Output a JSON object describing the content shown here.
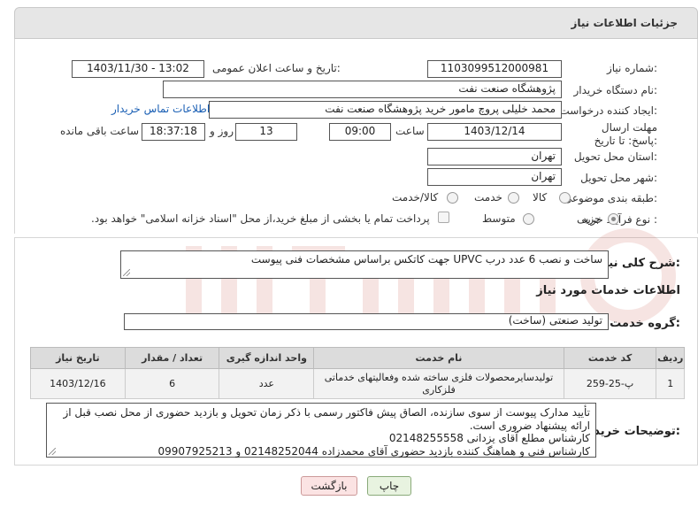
{
  "header": {
    "title": "جزئیات اطلاعات نیاز"
  },
  "fields": {
    "need_number_label": "شماره نیاز:",
    "need_number": "1103099512000981",
    "announce_label": "تاریخ و ساعت اعلان عمومی:",
    "announce_value": "1403/11/30 - 13:02",
    "buyer_org_label": "نام دستگاه خریدار:",
    "buyer_org": "پژوهشگاه صنعت نفت",
    "creator_label": "ایجاد کننده درخواست:",
    "creator": "محمد خلیلی پروچ مامور خرید پژوهشگاه صنعت نفت",
    "contact_link": "اطلاعات تماس خریدار",
    "deadline_label": "مهلت ارسال پاسخ: تا تاریخ:",
    "deadline_date": "1403/12/14",
    "time_label": "ساعت",
    "deadline_time": "09:00",
    "days_value": "13",
    "days_label": "روز و",
    "remaining_time": "18:37:18",
    "remaining_label": "ساعت باقی مانده",
    "province_label": "استان محل تحویل:",
    "province": "تهران",
    "city_label": "شهر محل تحویل:",
    "city": "تهران",
    "category_label": "طبقه بندی موضوعی:",
    "category_options": [
      "کالا",
      "خدمت",
      "کالا/خدمت"
    ],
    "process_label": "نوع فرآیند خرید :",
    "process_options": [
      "جزیی",
      "متوسط"
    ],
    "payment_note": "پرداخت تمام یا بخشی از مبلغ خرید،از محل \"اسناد خزانه اسلامی\" خواهد بود."
  },
  "description": {
    "label": "شرح کلی نیاز:",
    "text": "ساخت و نصب 6 عدد درب UPVC جهت کاتکس براساس مشخصات فنی پیوست"
  },
  "services": {
    "section_title": "اطلاعات خدمات مورد نیاز",
    "group_label": "گروه خدمت:",
    "group_value": "تولید صنعتی (ساخت)",
    "columns": [
      "ردیف",
      "کد خدمت",
      "نام خدمت",
      "واحد اندازه گیری",
      "تعداد / مقدار",
      "تاریخ نیاز"
    ],
    "rows": [
      [
        "1",
        "پ-25-259",
        "تولیدسایرمحصولات فلزی ساخته شده وفعالیتهای خدماتی فلزکاری",
        "عدد",
        "6",
        "1403/12/16"
      ]
    ]
  },
  "buyer_notes": {
    "label": "توضیحات خریدار:",
    "lines": [
      "تأیید مدارک پیوست از سوی سازنده، الصاق پیش فاکتور رسمی با ذکر زمان تحویل و بازدید حضوری از محل نصب قبل از ارائه پیشنهاد ضروری است.",
      "کارشناس مطلع آقای یزدانی 02148255558",
      "کارشناس فنی و هماهنگ کننده بازدید حضوری آقای محمدزاده 02148252044 و 09907925213"
    ]
  },
  "buttons": {
    "print": "چاپ",
    "back": "بازگشت"
  },
  "colors": {
    "link": "#1a5fb4",
    "header_bg": "#e6e6e6",
    "print_bg": "#e8f3e0",
    "back_bg": "#fbe3e3"
  }
}
